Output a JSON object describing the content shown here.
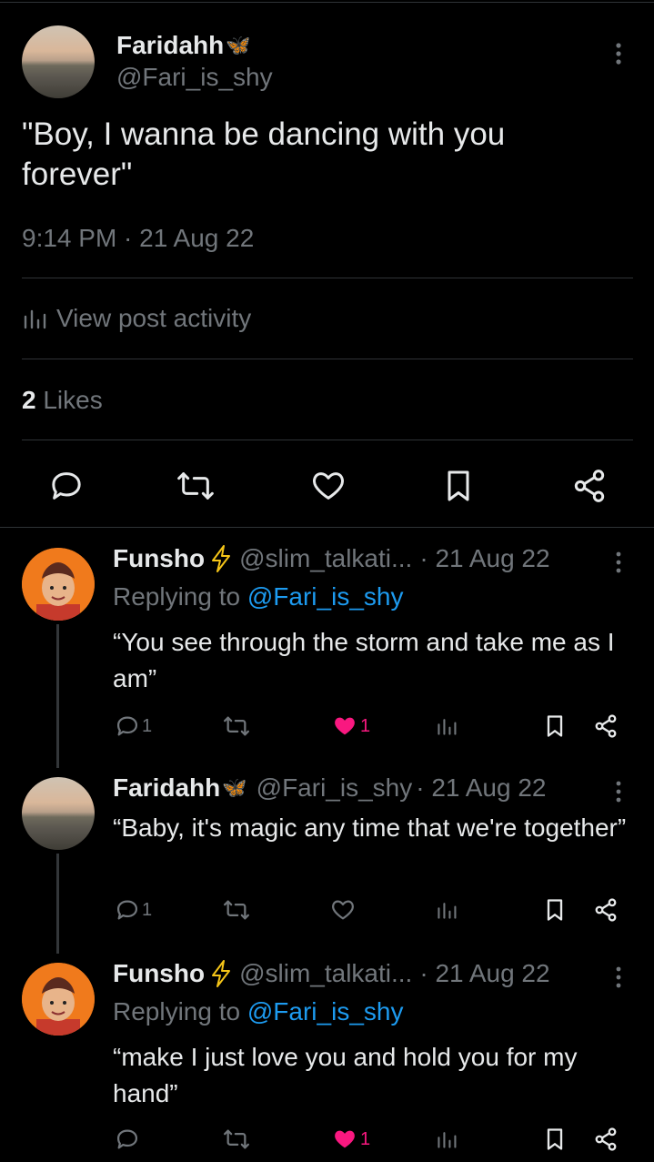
{
  "main": {
    "author_name": "Faridahh",
    "author_emoji": "🦋",
    "author_handle": "@Fari_is_shy",
    "text": "\"Boy, I wanna be dancing with you forever\"",
    "timestamp": "9:14 PM · 21 Aug 22",
    "activity_label": "View post activity",
    "likes_count": "2",
    "likes_label": "Likes"
  },
  "replies": [
    {
      "name": "Funsho",
      "handle": "@slim_talkati...",
      "date": "· 21 Aug 22",
      "replying_prefix": "Replying to",
      "replying_to": "@Fari_is_shy",
      "text": "“You see through the storm and take me as I am”",
      "reply_count": "1",
      "retweet_count": "",
      "like_count": "1",
      "liked": true
    },
    {
      "name": "Faridahh",
      "emoji": "🦋",
      "handle": "@Fari_is_shy",
      "date": "· 21 Aug 22",
      "text": "“Baby, it's magic any time that we're together”",
      "reply_count": "1",
      "retweet_count": "",
      "like_count": "",
      "liked": false
    },
    {
      "name": "Funsho",
      "handle": "@slim_talkati...",
      "date": "· 21 Aug 22",
      "replying_prefix": "Replying to",
      "replying_to": "@Fari_is_shy",
      "text": "“make I just love you and hold you for my hand”",
      "reply_count": "",
      "retweet_count": "",
      "like_count": "1",
      "liked": true
    }
  ],
  "colors": {
    "background": "#000000",
    "text": "#e7e9ea",
    "muted": "#71767b",
    "link": "#1d9bf0",
    "like": "#f91880",
    "divider": "#2f3336"
  }
}
